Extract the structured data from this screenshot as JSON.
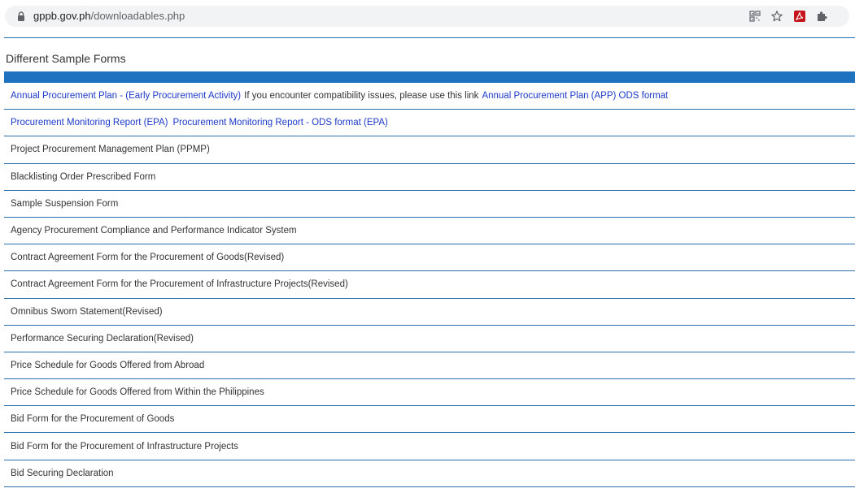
{
  "browser": {
    "url_domain": "gppb.gov.ph",
    "url_path": "/downloadables.php",
    "icons": [
      "lock-icon",
      "qr-code-icon",
      "star-icon",
      "pdf-extension-icon",
      "puzzle-extension-icon"
    ]
  },
  "colors": {
    "accent": "#1f72c0",
    "rule": "#2a6fad",
    "link": "#1c39c9",
    "text": "#333333",
    "omnibox": "#f1f3f4"
  },
  "page": {
    "title": "Different Sample Forms"
  },
  "forms": {
    "row1": {
      "link1": "Annual Procurement Plan - (Early Procurement Activity)",
      "text": "If you encounter compatibility issues, please use this link",
      "link2": "Annual Procurement Plan (APP) ODS format"
    },
    "row2": {
      "link1": "Procurement Monitoring Report (EPA)",
      "link2": "Procurement Monitoring Report - ODS format (EPA)"
    },
    "items": [
      "Project Procurement Management Plan (PPMP)",
      "Blacklisting Order Prescribed Form",
      "Sample Suspension Form",
      "Agency Procurement Compliance and Performance Indicator System",
      "Contract Agreement Form for the Procurement of Goods(Revised)",
      "Contract Agreement Form for the Procurement of Infrastructure Projects(Revised)",
      "Omnibus Sworn Statement(Revised)",
      "Performance Securing Declaration(Revised)",
      "Price Schedule for Goods Offered from Abroad",
      "Price Schedule for Goods Offered from Within the Philippines",
      "Bid Form for the Procurement of Goods",
      "Bid Form for the Procurement of Infrastructure Projects",
      "Bid Securing Declaration"
    ]
  }
}
